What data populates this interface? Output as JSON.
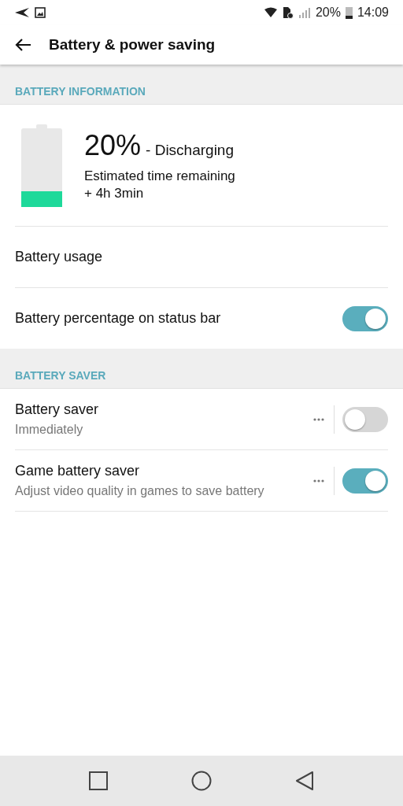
{
  "status_bar": {
    "battery_text": "20%",
    "time": "14:09"
  },
  "app_bar": {
    "title": "Battery & power saving"
  },
  "sections": [
    {
      "header": "BATTERY INFORMATION",
      "items": [
        {
          "kind": "battery",
          "percent": "20%",
          "state": "- Discharging",
          "line1": "Estimated time remaining",
          "line2": "+ 4h 3min"
        },
        {
          "kind": "plain",
          "title": "Battery usage"
        },
        {
          "kind": "switch",
          "title": "Battery percentage on status bar",
          "on": true
        }
      ]
    },
    {
      "header": "BATTERY SAVER",
      "items": [
        {
          "kind": "switch_more",
          "title": "Battery saver",
          "subtitle": "Immediately",
          "on": false
        },
        {
          "kind": "switch_more",
          "title": "Game battery saver",
          "subtitle": "Adjust video quality in games to save battery",
          "on": true
        }
      ]
    }
  ]
}
